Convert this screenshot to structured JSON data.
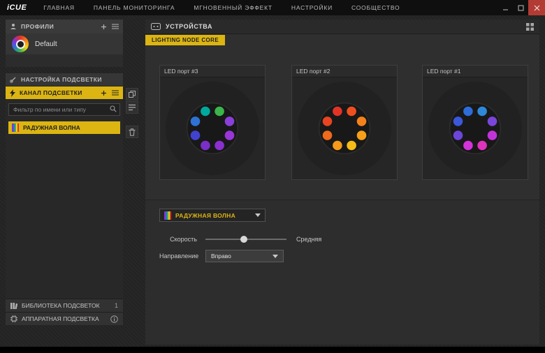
{
  "titlebar": {
    "logo": "iCUE",
    "menu": [
      "ГЛАВНАЯ",
      "ПАНЕЛЬ МОНИТОРИНГА",
      "МГНОВЕННЫЙ ЭФФЕКТ",
      "НАСТРОЙКИ",
      "СООБЩЕСТВО"
    ]
  },
  "sidebar": {
    "profiles_title": "ПРОФИЛИ",
    "profile_default": "Default",
    "lighting_setup_title": "НАСТРОЙКА ПОДСВЕТКИ",
    "channel_title": "КАНАЛ ПОДСВЕТКИ",
    "filter_placeholder": "Фильтр по имени или типу",
    "effect_item": "РАДУЖНАЯ ВОЛНА",
    "library_label": "БИБЛИОТЕКА ПОДСВЕТОК",
    "library_count": "1",
    "hardware_label": "АППАРАТНАЯ ПОДСВЕТКА"
  },
  "devices": {
    "title": "УСТРОЙСТВА",
    "tab_label": "LIGHTING NODE CORE",
    "fans": [
      {
        "label": "LED порт #3",
        "leds": [
          "#00a99d",
          "#3bb54a",
          "#8a3fd8",
          "#9a35d8",
          "#8a2fd0",
          "#7a2fc8",
          "#4242d0",
          "#2f72d4"
        ]
      },
      {
        "label": "LED порт #2",
        "leds": [
          "#e23327",
          "#ef4f1f",
          "#f5811b",
          "#f7a019",
          "#f7bb18",
          "#f49a1a",
          "#ef6a1d",
          "#e74422"
        ]
      },
      {
        "label": "LED порт #1",
        "leds": [
          "#2e6cd9",
          "#2f87d9",
          "#7a45d9",
          "#c433d9",
          "#df32bd",
          "#d333d9",
          "#6b46d9",
          "#3a58d9"
        ]
      }
    ]
  },
  "effect_panel": {
    "effect_name": "РАДУЖНАЯ ВОЛНА",
    "speed_label": "Скорость",
    "speed_value": "Средняя",
    "speed_percent": 47,
    "direction_label": "Направление",
    "direction_value": "Вправо"
  },
  "colors": {
    "accent": "#dcb512",
    "close_button": "#b23b34"
  }
}
